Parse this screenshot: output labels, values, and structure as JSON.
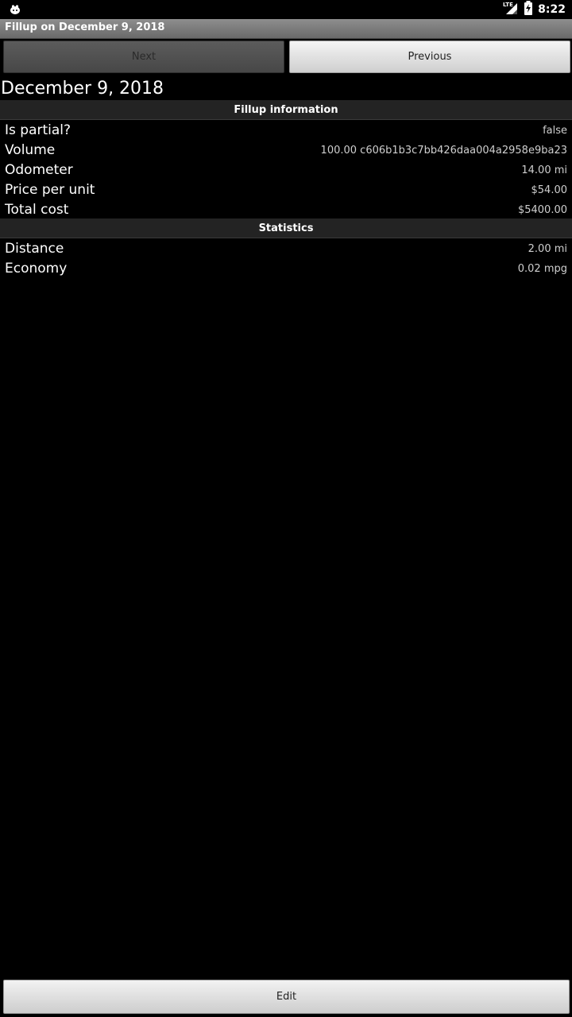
{
  "status_bar": {
    "time": "8:22",
    "network": "LTE",
    "icons": [
      "app-notification-icon",
      "lte-signal-icon",
      "battery-charging-icon"
    ]
  },
  "title_bar": {
    "title": "Fillup on December 9, 2018"
  },
  "nav": {
    "next_label": "Next",
    "previous_label": "Previous"
  },
  "date_heading": "December 9, 2018",
  "sections": {
    "fillup_info": {
      "title": "Fillup information",
      "rows": [
        {
          "label": "Is partial?",
          "value": "false"
        },
        {
          "label": "Volume",
          "value": "100.00 c606b1b3c7bb426daa004a2958e9ba23"
        },
        {
          "label": "Odometer",
          "value": "14.00 mi"
        },
        {
          "label": "Price per unit",
          "value": "$54.00"
        },
        {
          "label": "Total cost",
          "value": "$5400.00"
        }
      ]
    },
    "statistics": {
      "title": "Statistics",
      "rows": [
        {
          "label": "Distance",
          "value": "2.00 mi"
        },
        {
          "label": "Economy",
          "value": "0.02 mpg"
        }
      ]
    }
  },
  "edit_label": "Edit",
  "colors": {
    "background": "#000000",
    "title_bar": "#7c7c7c",
    "section_header": "#232323",
    "button_light": "#e0e0e0",
    "button_disabled": "#515151"
  }
}
